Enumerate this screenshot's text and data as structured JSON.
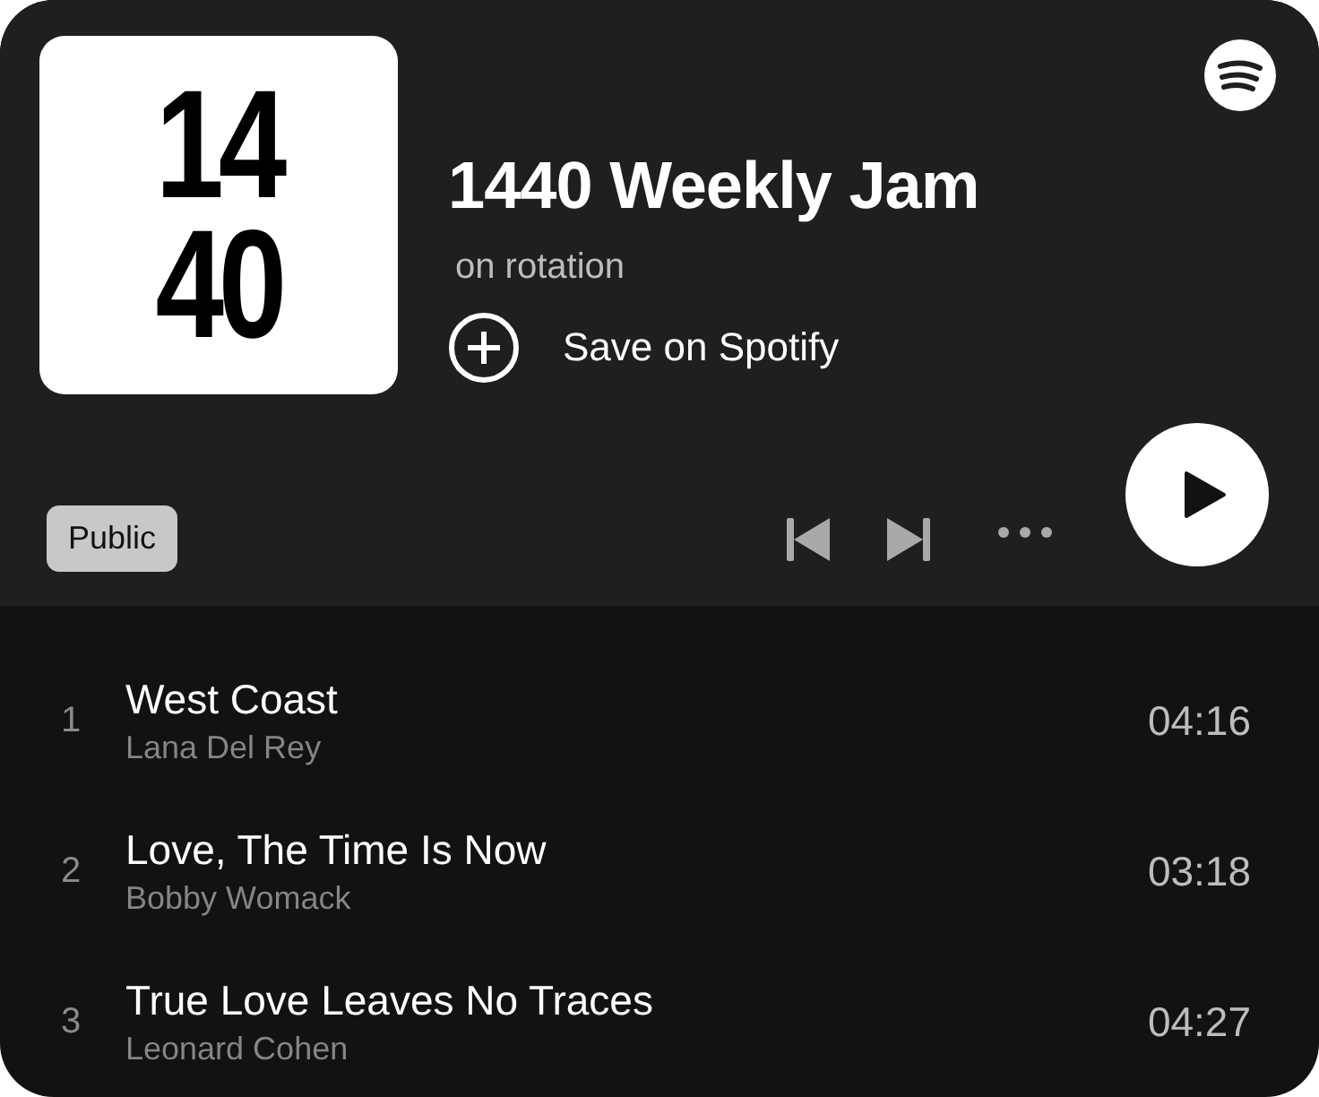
{
  "cover": {
    "lines": [
      "14",
      "40"
    ]
  },
  "playlist": {
    "title": "1440 Weekly Jam",
    "subtitle": "on rotation",
    "save_label": "Save on Spotify",
    "visibility": "Public"
  },
  "tracks": [
    {
      "number": "1",
      "title": "West Coast",
      "artist": "Lana Del Rey",
      "duration": "04:16"
    },
    {
      "number": "2",
      "title": "Love, The Time Is Now",
      "artist": "Bobby Womack",
      "duration": "03:18"
    },
    {
      "number": "3",
      "title": "True Love Leaves No Traces",
      "artist": "Leonard Cohen",
      "duration": "04:27"
    }
  ]
}
